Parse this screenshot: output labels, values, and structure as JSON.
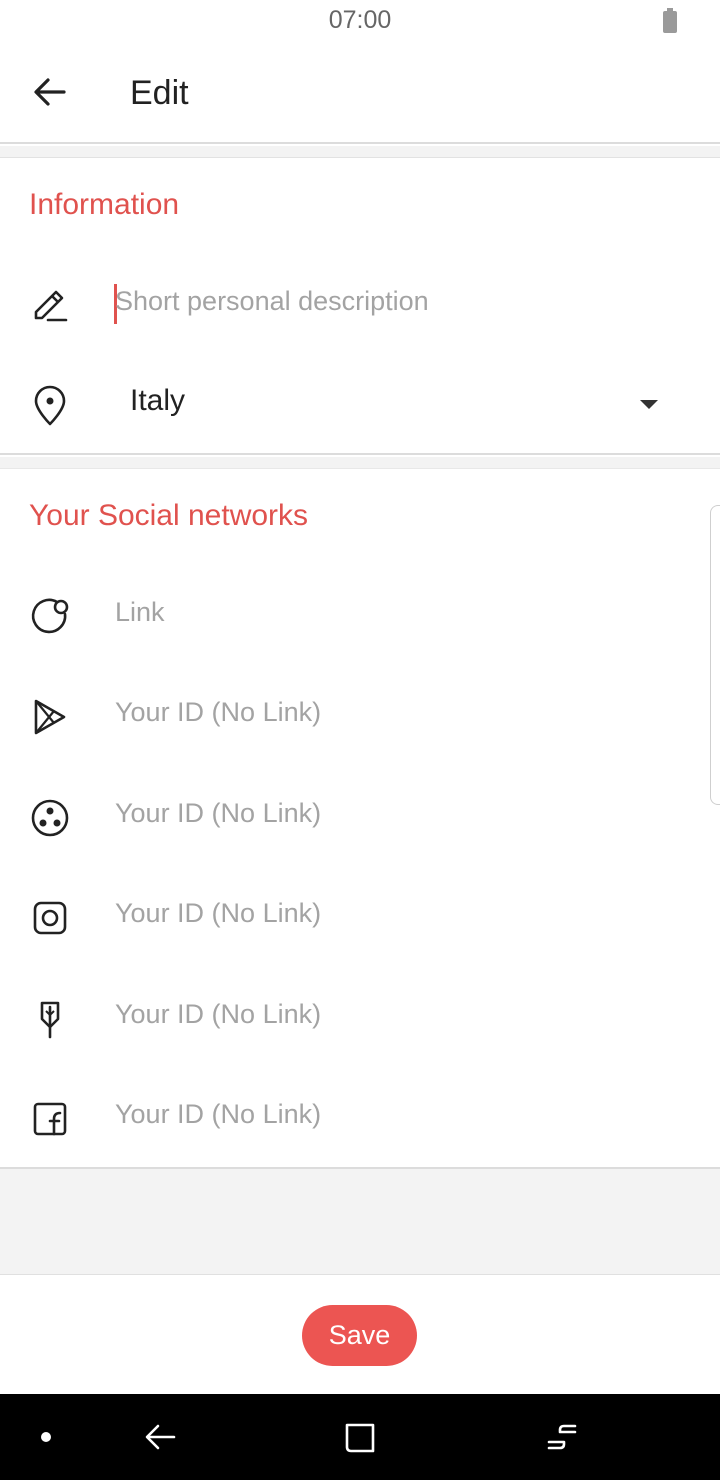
{
  "status_bar": {
    "time": "07:00",
    "battery_icon": "battery-icon"
  },
  "app_bar": {
    "title": "Edit",
    "back_icon": "arrow-left-icon"
  },
  "information": {
    "title": "Information",
    "description": {
      "icon": "pencil-icon",
      "placeholder": "Short personal description",
      "value": ""
    },
    "country": {
      "icon": "location-pin-icon",
      "value": "Italy",
      "dropdown_icon": "caret-down-icon"
    }
  },
  "social": {
    "title": "Your Social networks",
    "fields": [
      {
        "icon": "website-icon",
        "placeholder": "Link"
      },
      {
        "icon": "play-store-icon",
        "placeholder": "Your ID (No Link)"
      },
      {
        "icon": "dots-circle-icon",
        "placeholder": "Your ID (No Link)"
      },
      {
        "icon": "instagram-icon",
        "placeholder": "Your ID (No Link)"
      },
      {
        "icon": "feather-icon",
        "placeholder": "Your ID (No Link)"
      },
      {
        "icon": "facebook-icon",
        "placeholder": "Your ID (No Link)"
      }
    ]
  },
  "footer": {
    "save_label": "Save"
  },
  "colors": {
    "accent": "#e0524e",
    "button": "#ec5552",
    "placeholder": "#a3a3a3"
  },
  "system_nav": {
    "dot_icon": "dot-icon",
    "back_icon": "nav-back-icon",
    "home_icon": "nav-home-icon",
    "recents_icon": "nav-recents-icon"
  }
}
